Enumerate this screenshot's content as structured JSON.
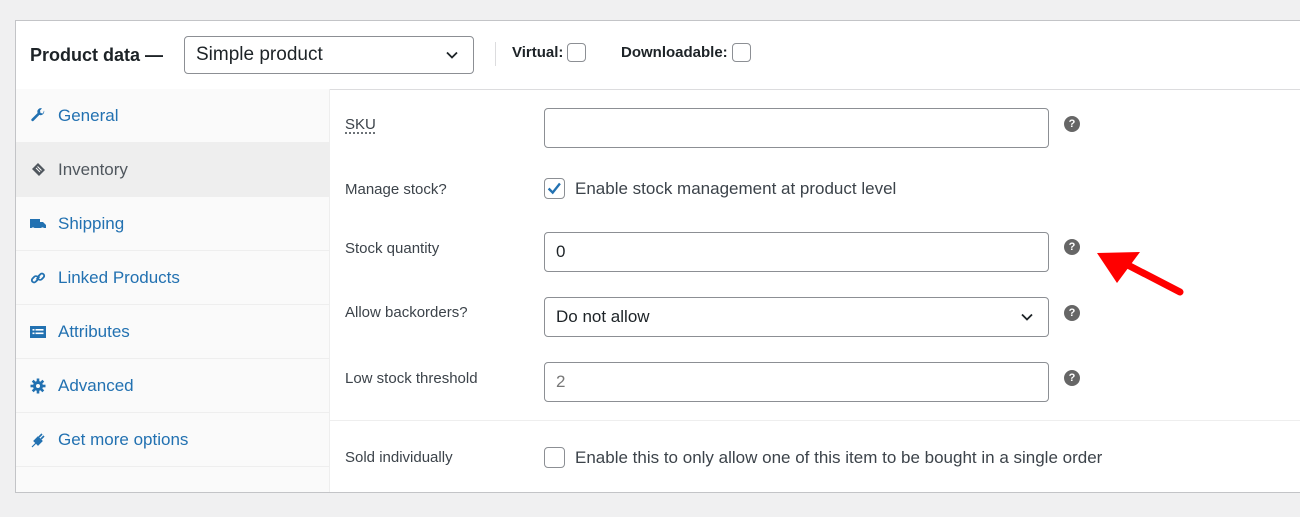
{
  "header": {
    "title": "Product data —",
    "product_type": "Simple product",
    "virtual_label": "Virtual:",
    "virtual_checked": false,
    "downloadable_label": "Downloadable:",
    "downloadable_checked": false
  },
  "sidebar": {
    "tabs": [
      {
        "label": "General",
        "icon": "wrench-icon",
        "active": false
      },
      {
        "label": "Inventory",
        "icon": "clipboard-tag-icon",
        "active": true
      },
      {
        "label": "Shipping",
        "icon": "truck-icon",
        "active": false
      },
      {
        "label": "Linked Products",
        "icon": "link-icon",
        "active": false
      },
      {
        "label": "Attributes",
        "icon": "list-card-icon",
        "active": false
      },
      {
        "label": "Advanced",
        "icon": "gear-icon",
        "active": false
      },
      {
        "label": "Get more options",
        "icon": "plug-icon",
        "active": false
      }
    ]
  },
  "inventory": {
    "sku_label": "SKU",
    "sku_value": "",
    "manage_stock_label": "Manage stock?",
    "manage_stock_checked": true,
    "manage_stock_text": "Enable stock management at product level",
    "stock_qty_label": "Stock quantity",
    "stock_qty_value": "0",
    "backorders_label": "Allow backorders?",
    "backorders_value": "Do not allow",
    "low_stock_label": "Low stock threshold",
    "low_stock_placeholder": "2",
    "sold_individually_label": "Sold individually",
    "sold_individually_checked": false,
    "sold_individually_text": "Enable this to only allow one of this item to be bought in a single order",
    "help_glyph": "?"
  },
  "annotation": {
    "arrow_color": "#ff0000"
  }
}
